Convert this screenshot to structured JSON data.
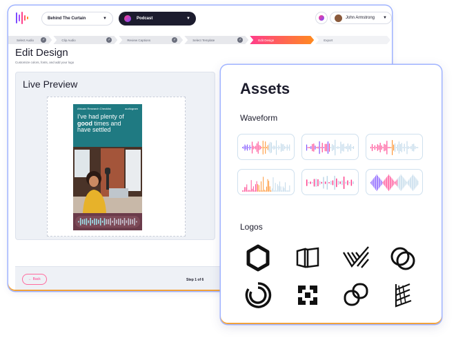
{
  "app": {
    "show_selector": "Behind The Curtain",
    "format_selector": "Podcast",
    "user_name": "John Armstrong"
  },
  "steps": [
    {
      "label": "Select Audio",
      "state": "done"
    },
    {
      "label": "Clip Audio",
      "state": "done"
    },
    {
      "label": "Review Captions",
      "state": "done"
    },
    {
      "label": "Select Template",
      "state": "done"
    },
    {
      "label": "Edit Design",
      "state": "active"
    },
    {
      "label": "Export",
      "state": "pending"
    }
  ],
  "page": {
    "title": "Edit Design",
    "subtitle": "Customize colors, fonts, and add your logo"
  },
  "preview": {
    "title": "Live Preview",
    "card_header": "Africain Research Checklist",
    "card_brand": "audiogram",
    "quote_line1": "I've had plenty of",
    "quote_bold": "good",
    "quote_rest": "times and",
    "quote_line3": "have settled"
  },
  "footer": {
    "back_label": "Back",
    "step_text": "Step 1 of 6"
  },
  "assets": {
    "title": "Assets",
    "waveform_label": "Waveform",
    "logos_label": "Logos"
  },
  "colors": {
    "accent_pink": "#ff3d8b",
    "accent_orange": "#ff8a1f",
    "accent_purple": "#7a4cff",
    "wave_light": "#bcd6e8",
    "dark": "#1c1c2e"
  },
  "icons": [
    "logo-mark-icon",
    "chevron-down-icon",
    "check-icon",
    "back-arrow-icon"
  ]
}
